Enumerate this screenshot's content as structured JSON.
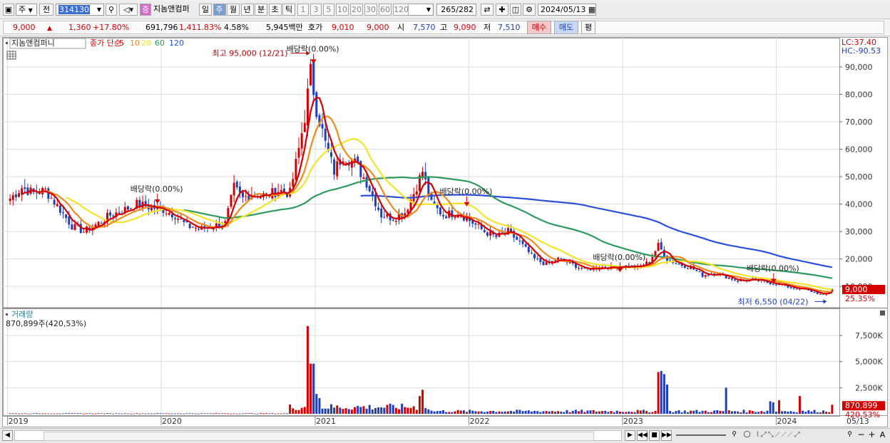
{
  "toolbar": {
    "mode": "주",
    "prev": "전",
    "code": "314130",
    "name": "지놈앤컴퍼",
    "period_tabs": [
      "일",
      "주",
      "월",
      "년",
      "분",
      "초",
      "틱"
    ],
    "selected_period": "주",
    "intervals": [
      "1",
      "3",
      "5",
      "10",
      "20",
      "30",
      "60",
      "120"
    ],
    "count": "265",
    "total": "/282",
    "date": "2024/05/13"
  },
  "quote": {
    "price": "9,000",
    "change": "1,360",
    "change_pct": "+17.80%",
    "volume": "691,796",
    "volume_ratio": "1,411.83%",
    "turnover": "4.58%",
    "amount": "5,945백만",
    "bid_label": "호가",
    "bid": "9,010",
    "ask": "9,000",
    "open_label": "시",
    "open": "7,570",
    "high_label": "고",
    "high": "9,090",
    "low_label": "저",
    "low": "7,510",
    "buy": "매수",
    "sell": "매도",
    "eval": "평"
  },
  "colors": {
    "up": "#d40000",
    "down": "#1d3fb8",
    "ma5": "#d40000",
    "ma10": "#f08a1c",
    "ma20": "#f2e42b",
    "ma60": "#2e9a5e",
    "ma120": "#2b4fd6"
  },
  "chart_data": {
    "type": "candlestick",
    "price_panel": {
      "legend_name": "지놈앤컴퍼니",
      "legend_items": [
        "종가 단순",
        "5",
        "10",
        "20",
        "60",
        "120"
      ],
      "lc": "LC:37.40",
      "hc": "HC:-90.53",
      "ylim": [
        2500,
        97000
      ],
      "y_ticks": [
        10000,
        20000,
        30000,
        40000,
        50000,
        60000,
        70000,
        80000,
        90000
      ],
      "y_tick_labels": [
        "10,000",
        "20,000",
        "30,000",
        "40,000",
        "50,000",
        "60,000",
        "70,000",
        "80,000",
        "90,000"
      ],
      "current_price_label": "9,000",
      "current_pct_label": "25.35%",
      "annotations": [
        {
          "text": "최고 95,000 (12/21)",
          "date": "2020-12-21",
          "value": 95000
        },
        {
          "text": "최저 6,550 (04/22)",
          "date": "2024-04-22",
          "value": 6550
        },
        {
          "text": "배당락(0.00%)",
          "date": "2020-12-28",
          "value": 93000
        },
        {
          "text": "배당락(0.00%)",
          "date": "2019-12-23",
          "value": 42000
        },
        {
          "text": "배당락(0.00%)",
          "date": "2021-12-27",
          "value": 41000
        },
        {
          "text": "배당락(0.00%)",
          "date": "2022-12-26",
          "value": 17000
        },
        {
          "text": "배당락(0.00%)",
          "date": "2023-12-26",
          "value": 13000
        }
      ],
      "close_anchors": [
        [
          "2019-01-07",
          42000
        ],
        [
          "2019-02-04",
          46000
        ],
        [
          "2019-03-04",
          44000
        ],
        [
          "2019-04-01",
          45000
        ],
        [
          "2019-05-06",
          38000
        ],
        [
          "2019-06-03",
          32000
        ],
        [
          "2019-07-01",
          30000
        ],
        [
          "2019-08-05",
          33000
        ],
        [
          "2019-09-02",
          36000
        ],
        [
          "2019-10-07",
          38000
        ],
        [
          "2019-11-04",
          40000
        ],
        [
          "2019-12-02",
          39000
        ],
        [
          "2020-01-06",
          38000
        ],
        [
          "2020-02-03",
          36000
        ],
        [
          "2020-03-02",
          32000
        ],
        [
          "2020-04-06",
          31000
        ],
        [
          "2020-05-04",
          32000
        ],
        [
          "2020-06-01",
          33000
        ],
        [
          "2020-06-22",
          46000
        ],
        [
          "2020-07-13",
          42000
        ],
        [
          "2020-08-03",
          44000
        ],
        [
          "2020-09-07",
          43000
        ],
        [
          "2020-10-05",
          45000
        ],
        [
          "2020-11-02",
          44000
        ],
        [
          "2020-11-23",
          60000
        ],
        [
          "2020-12-07",
          72000
        ],
        [
          "2020-12-21",
          88000
        ],
        [
          "2021-01-04",
          75000
        ],
        [
          "2021-01-25",
          62000
        ],
        [
          "2021-02-15",
          52000
        ],
        [
          "2021-03-08",
          58000
        ],
        [
          "2021-04-05",
          55000
        ],
        [
          "2021-05-03",
          48000
        ],
        [
          "2021-06-07",
          36000
        ],
        [
          "2021-07-05",
          35000
        ],
        [
          "2021-08-02",
          37000
        ],
        [
          "2021-08-23",
          44000
        ],
        [
          "2021-09-13",
          52000
        ],
        [
          "2021-10-04",
          40000
        ],
        [
          "2021-11-01",
          36000
        ],
        [
          "2021-12-06",
          37000
        ],
        [
          "2022-01-03",
          34000
        ],
        [
          "2022-02-07",
          30000
        ],
        [
          "2022-03-07",
          28000
        ],
        [
          "2022-04-04",
          30000
        ],
        [
          "2022-05-02",
          26000
        ],
        [
          "2022-06-06",
          20000
        ],
        [
          "2022-07-04",
          18000
        ],
        [
          "2022-08-01",
          20000
        ],
        [
          "2022-09-05",
          18000
        ],
        [
          "2022-10-03",
          16000
        ],
        [
          "2022-11-07",
          17000
        ],
        [
          "2022-12-05",
          17000
        ],
        [
          "2023-01-02",
          17500
        ],
        [
          "2023-02-06",
          17000
        ],
        [
          "2023-03-06",
          19000
        ],
        [
          "2023-03-27",
          25000
        ],
        [
          "2023-04-17",
          20000
        ],
        [
          "2023-05-15",
          18000
        ],
        [
          "2023-06-12",
          17000
        ],
        [
          "2023-07-10",
          14000
        ],
        [
          "2023-08-07",
          15000
        ],
        [
          "2023-09-04",
          13500
        ],
        [
          "2023-10-02",
          12000
        ],
        [
          "2023-11-06",
          12500
        ],
        [
          "2023-12-04",
          11500
        ],
        [
          "2024-01-01",
          11000
        ],
        [
          "2024-02-05",
          9500
        ],
        [
          "2024-03-04",
          9000
        ],
        [
          "2024-04-01",
          7800
        ],
        [
          "2024-04-22",
          6800
        ],
        [
          "2024-05-13",
          9000
        ]
      ],
      "moving_averages": [
        5,
        10,
        20,
        60,
        120
      ]
    },
    "volume_panel": {
      "title": "거래량",
      "info": "870,899주(420,53%)",
      "ylim": [
        0,
        9000000
      ],
      "y_ticks": [
        2500000,
        5000000,
        7500000
      ],
      "y_tick_labels": [
        "2,500K",
        "5,000K",
        "7,500K"
      ],
      "current_label": "870,899",
      "current_pct_label": "420,53%",
      "spikes": [
        [
          "2020-12-14",
          8400000
        ],
        [
          "2020-12-21",
          4800000
        ],
        [
          "2020-12-28",
          4800000
        ],
        [
          "2021-01-04",
          1900000
        ],
        [
          "2021-01-11",
          1500000
        ],
        [
          "2021-09-06",
          1700000
        ],
        [
          "2021-09-13",
          2300000
        ],
        [
          "2023-03-27",
          4000000
        ],
        [
          "2023-04-03",
          4100000
        ],
        [
          "2023-04-10",
          3800000
        ],
        [
          "2023-04-17",
          2800000
        ],
        [
          "2023-09-04",
          2500000
        ],
        [
          "2023-12-18",
          1200000
        ],
        [
          "2023-12-25",
          1100000
        ],
        [
          "2024-01-08",
          1300000
        ],
        [
          "2024-02-26",
          1700000
        ],
        [
          "2024-05-13",
          870899
        ]
      ]
    },
    "x_axis": {
      "start": "2018-12-31",
      "end": "2024-05-20",
      "ticks": [
        "2019-01-01",
        "2020-01-01",
        "2021-01-01",
        "2022-01-01",
        "2023-01-01",
        "2024-01-01",
        "2024-05-13"
      ],
      "tick_labels": [
        "2019",
        "2020",
        "2021",
        "2022",
        "2023",
        "2024",
        "05/13"
      ]
    }
  }
}
